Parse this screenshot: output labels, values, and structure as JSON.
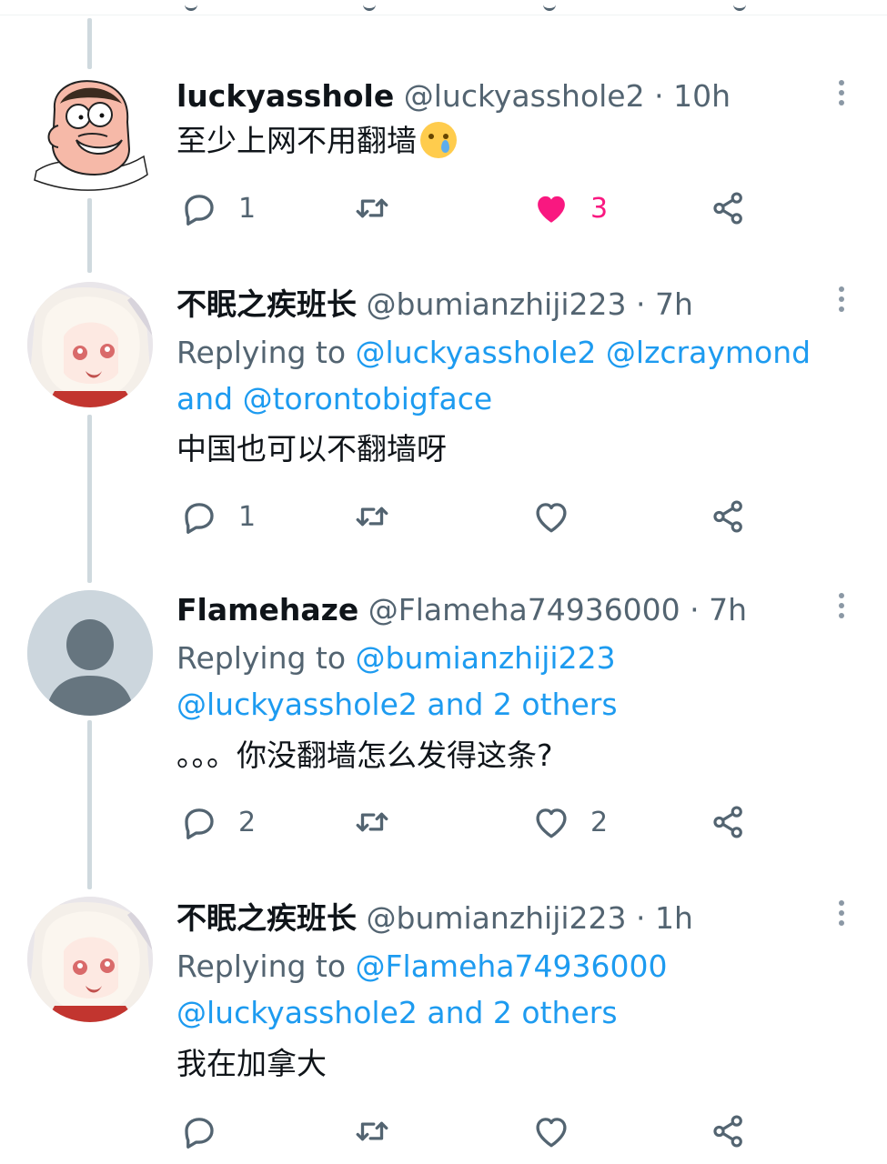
{
  "tweets": [
    {
      "name": "luckyasshole",
      "meta": "@luckyasshole2 · 10h",
      "body": "至少上网不用翻墙",
      "emoji": "crying-face-emoji",
      "reply_count": "1",
      "like_count": "3",
      "liked": true
    },
    {
      "name": "不眠之疾班长",
      "meta": "@bumianzhiji223 · 7h",
      "replying_prefix": "Replying to ",
      "mention1": "@luckyasshole2",
      "mention2": "@lzcraymond",
      "and_text": "and",
      "mention3": "@torontobigface",
      "body": "中国也可以不翻墙呀",
      "reply_count": "1",
      "like_count": ""
    },
    {
      "name": "Flamehaze",
      "meta": "@Flameha74936000 · 7h",
      "replying_prefix": "Replying to ",
      "mention1": "@bumianzhiji223",
      "mention2": "@luckyasshole2 and 2 others",
      "body": "。。。你没翻墙怎么发得这条?",
      "reply_count": "2",
      "like_count": "2"
    },
    {
      "name": "不眠之疾班长",
      "meta": "@bumianzhiji223 · 1h",
      "replying_prefix": "Replying to ",
      "mention1": "@Flameha74936000",
      "mention2": "@luckyasshole2 and 2 others",
      "body": "我在加拿大",
      "reply_count": "",
      "like_count": ""
    }
  ],
  "colors": {
    "accent": "#1d9bf0",
    "like": "#f91880",
    "muted": "#536471",
    "thread_line": "#cfd9de"
  }
}
